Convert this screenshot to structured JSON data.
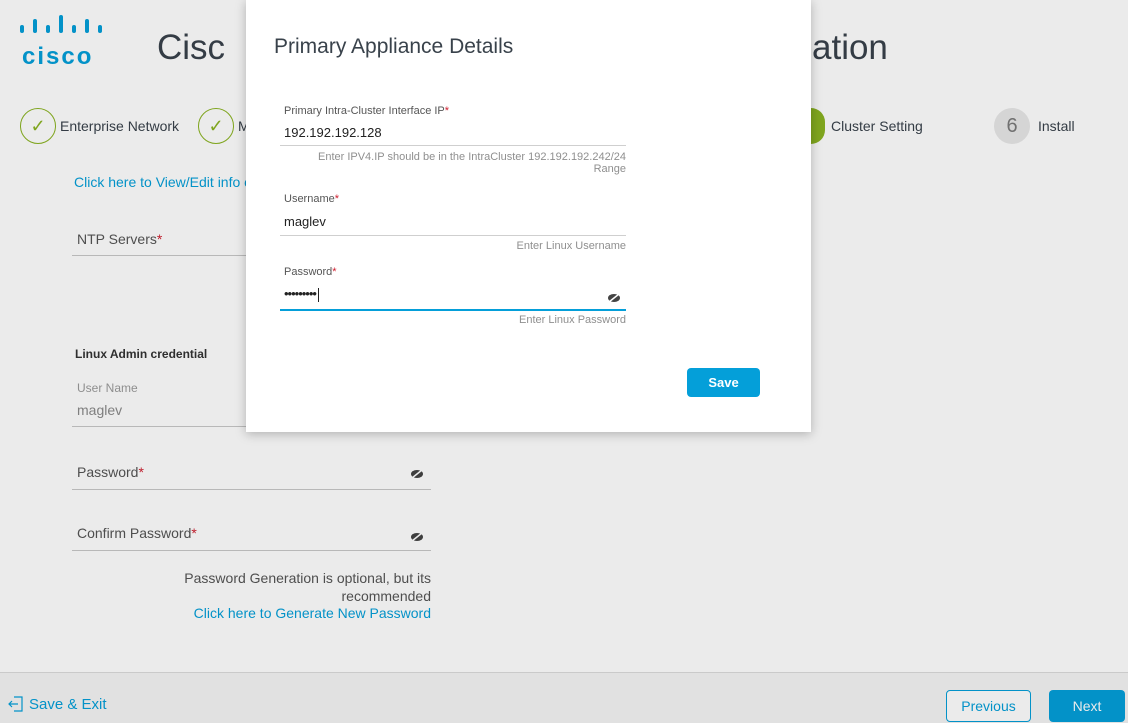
{
  "header": {
    "brand": "cisco",
    "app_title": "Cisc",
    "app_title_tail": "ation"
  },
  "stepper": {
    "steps": [
      {
        "label": "Enterprise Network",
        "state": "done"
      },
      {
        "label": "M",
        "state": "done"
      },
      {
        "label": "Cluster Setting",
        "state": "active"
      },
      {
        "number": "6",
        "label": "Install",
        "state": "pending"
      }
    ]
  },
  "form": {
    "edit_link": "Click here to View/Edit info c",
    "ntp_label": "NTP Servers",
    "linux_admin_heading": "Linux Admin credential",
    "username_label": "User Name",
    "username_value": "maglev",
    "password_label": "Password",
    "confirm_password_label": "Confirm Password",
    "required_mark": "*",
    "generation_note_line1": "Password Generation is optional, but its",
    "generation_note_line2": "recommended",
    "generate_link": "Click here to Generate New Password"
  },
  "footer": {
    "save_exit": "Save & Exit",
    "previous": "Previous",
    "next": "Next"
  },
  "modal": {
    "title": "Primary Appliance Details",
    "ip_label": "Primary Intra-Cluster Interface IP",
    "ip_value": "192.192.192.128",
    "ip_help_line1": "Enter IPV4.IP should be in the IntraCluster 192.192.192.242/24",
    "ip_help_line2": "Range",
    "username_label": "Username",
    "username_value": "maglev",
    "username_help": "Enter Linux Username",
    "password_label": "Password",
    "password_value": "•••••••••",
    "password_help": "Enter Linux Password",
    "save": "Save"
  },
  "colors": {
    "accent": "#049fd9",
    "success": "#8ab321",
    "required": "#cf2030",
    "text": "#39424b"
  }
}
